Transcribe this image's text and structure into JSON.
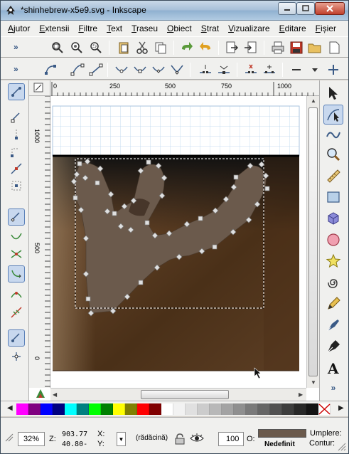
{
  "window": {
    "title": "*shinhebrew-x5e9.svg - Inkscape"
  },
  "menu": [
    "Ajutor",
    "Extensii",
    "Filtre",
    "Text",
    "Traseu",
    "Obiect",
    "Strat",
    "Vizualizare",
    "Editare",
    "Fișier"
  ],
  "rulers": {
    "h_ticks": [
      "0",
      "250",
      "500",
      "750",
      "1000"
    ],
    "v_ticks": [
      "1000",
      "500",
      "0"
    ]
  },
  "status": {
    "zoom": "32%",
    "cursor_x_label": "X:",
    "cursor_y_label": "Y:",
    "cursor_x": "903.77",
    "cursor_y": "40.80-",
    "z_label": "Z:",
    "layer": "(rădăcină)",
    "opacity_label": "O:",
    "opacity": "100",
    "fill_label": "Umplere:",
    "stroke_label": "Contur:",
    "stroke_value": "Nedefinit"
  },
  "colors": {
    "selected_fill": "#6b5a4c",
    "accent": "#3a5a86",
    "palette": [
      "#ff00ff",
      "#800080",
      "#0000ff",
      "#000080",
      "#00ffff",
      "#008080",
      "#00ff00",
      "#008000",
      "#ffff00",
      "#808000",
      "#ff0000",
      "#800000",
      "#ffffff",
      "#f2f2f2",
      "#e0e0e0",
      "#cccccc",
      "#b8b8b8",
      "#a3a3a3",
      "#8f8f8f",
      "#7a7a7a",
      "#666666",
      "#515151",
      "#3d3d3d",
      "#282828",
      "#141414"
    ]
  }
}
